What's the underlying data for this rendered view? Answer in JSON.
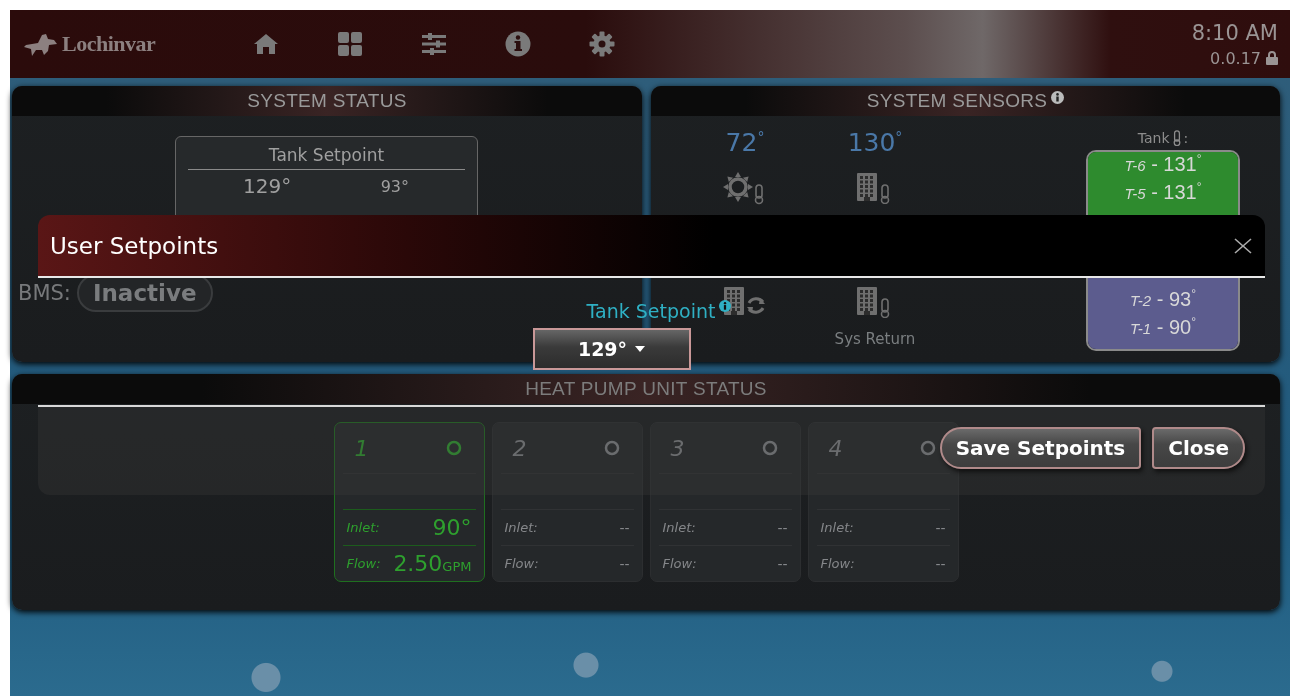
{
  "header": {
    "logo": "Lochinvar",
    "nav": [
      {
        "kind": "home"
      },
      {
        "kind": "grid"
      },
      {
        "kind": "sliders"
      },
      {
        "kind": "info"
      },
      {
        "kind": "settings"
      }
    ],
    "time": "8:10 AM",
    "version": "0.0.17",
    "locked": true
  },
  "system_status": {
    "title": "SYSTEM STATUS",
    "setpoint_card": {
      "title": "Tank Setpoint",
      "values": [
        "129°",
        "93°"
      ]
    },
    "bms": {
      "label": "BMS:",
      "value": "Inactive"
    }
  },
  "system_sensors": {
    "title": "SYSTEM SENSORS",
    "columns": [
      {
        "kind": "outdoor",
        "value": "72$^{°}$"
      },
      {
        "kind": "building",
        "value": "130$^{°}$"
      }
    ],
    "lower_columns": [
      {
        "kind": "recirc"
      },
      {
        "kind": "return",
        "label": "Sys Return"
      }
    ],
    "tank": {
      "label": "Tank",
      "suffix": ":",
      "groups": [
        {
          "color": "#2e8b2e",
          "sensors": [
            "*T-6* - 131$^{°}$",
            "*T-5* - 131$^{°}$"
          ]
        },
        {
          "color": "#5c5c8e",
          "sensors": [
            "*T-2* - 93$^{°}$",
            "*T-1* - 90$^{°}$"
          ]
        }
      ]
    }
  },
  "heat_pump_status": {
    "title": "HEAT PUMP UNIT STATUS",
    "units": [
      {
        "number": "1",
        "active": true,
        "inlet": {
          "label": "Inlet:",
          "value": "90°"
        },
        "flow": {
          "label": "Flow:",
          "value": "2.50",
          "unit": "GPM"
        }
      },
      {
        "number": "2",
        "active": false,
        "inlet": {
          "label": "Inlet:",
          "value": "--"
        },
        "flow": {
          "label": "Flow:",
          "value": "--"
        }
      },
      {
        "number": "3",
        "active": false,
        "inlet": {
          "label": "Inlet:",
          "value": "--"
        },
        "flow": {
          "label": "Flow:",
          "value": "--"
        }
      },
      {
        "number": "4",
        "active": false,
        "inlet": {
          "label": "Inlet:",
          "value": "--"
        },
        "flow": {
          "label": "Flow:",
          "value": "--"
        }
      }
    ]
  },
  "dialog": {
    "title": "User Setpoints",
    "field": {
      "label": "Tank Setpoint",
      "value": "129°"
    },
    "buttons": [
      {
        "label": "Save Setpoints"
      },
      {
        "label": "Close"
      }
    ]
  }
}
